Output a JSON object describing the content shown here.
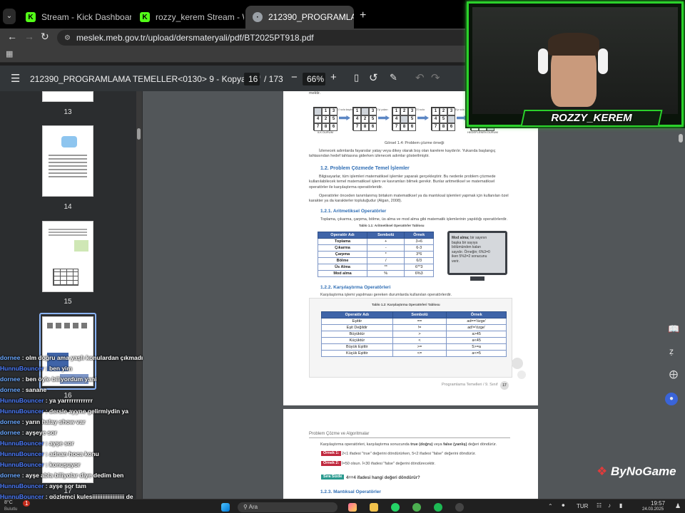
{
  "tabs": [
    {
      "label": "Stream - Kick Dashboard",
      "favicon_color": "#53fc18"
    },
    {
      "label": "rozzy_kerem Stream - Watch Li",
      "favicon_color": "#53fc18"
    },
    {
      "label": "212390_PROGRAMLAMA TEME",
      "favicon_color": "#9aa0a6"
    }
  ],
  "address": {
    "url": "meslek.meb.gov.tr/upload/dersmateryali/pdf/BT2025PT918.pdf"
  },
  "pdf_toolbar": {
    "title": "212390_PROGRAMLAMA TEMELLER<0130> 9 - Kopya.pdf",
    "current_page": "16",
    "total_pages": "/ 173",
    "zoom": "66%"
  },
  "thumbnails": [
    "13",
    "14",
    "15",
    "16",
    "17"
  ],
  "page1": {
    "intro_text": "mektir.",
    "start_label": "İLK DURUM",
    "goal_label": "HEDEFLENEN DURUM",
    "arrow_labels": [
      "1'i sola kaydır",
      "2'yi yukarı",
      "3'ü sola",
      "6'yı sola"
    ],
    "figure_caption": "Görsel 1.4: Problem çözme örneği",
    "para1": "İzlenecek adımlarda fayanslar yatay veya dikey olarak boş olan karelere kaydırılır. Yukarıda başlangıç tahtasından hedef tahtasına giderken izlenecek adımlar gösterilmiştir.",
    "section_title": "1.2. Problem Çözmede Temel İşlemler",
    "para2": "Bilgisayarlar, tüm işlemleri matematiksel işlemler yaparak gerçekleştirir. Bu nedenle problem çözmede kullanılabilecek temel matematiksel işlem ve kavramları bilmek gerekir. Bunlar aritmetiksel ve matematiksel operatörler ile karşılaştırma operatörleridir.",
    "para3": "Operatörler önceden tanımlanmış birtakım matematiksel ya da mantıksal işlemleri yapmak için kullanılan özel karakter ya da karakterler topluluğudur (Algan, 2008).",
    "sub1_title": "1.2.1. Aritmetiksel Operatörler",
    "sub1_text": "Toplama, çıkarma, çarpma, bölme, üs alma ve mod alma gibi matematik işlemlerinin yapıldığı operatörlerdir.",
    "table1_caption": "Tablo 1.1: Aritmetiksel Operatörler Tablosu",
    "table1_headers": [
      "Operatör Adı",
      "Sembolü",
      "Örnek"
    ],
    "table1_rows": [
      [
        "Toplama",
        "+",
        "3+6"
      ],
      [
        "Çıkarma",
        "-",
        "6-3"
      ],
      [
        "Çarpma",
        "*",
        "3*6"
      ],
      [
        "Bölme",
        "/",
        "6/3"
      ],
      [
        "Üs Alma",
        "**",
        "6**3"
      ],
      [
        "Mod alma",
        "%",
        "6%3"
      ]
    ],
    "monitor_note_bold": "Mod alma;",
    "monitor_note": "bir sayının başka bir sayıya bölümünden kalan sayıdır. Örneğin; 6%3=0 iken 5%3=2 sonucunu verir.",
    "sub2_title": "1.2.2. Karşılaştırma Operatörleri",
    "sub2_text": "Karşılaştırma işlemi yapılması gereken durumlarda kullanılan operatörlerdir.",
    "table2_caption": "Tablo 1.2: Karşılaştırma Operatörleri Tablosu",
    "table2_headers": [
      "Operatör Adı",
      "Sembolü",
      "Örnek"
    ],
    "table2_rows": [
      [
        "Eşittir",
        "==",
        "ad=='özge'"
      ],
      [
        "Eşit Değildir",
        "!=",
        "ad!='özge'"
      ],
      [
        "Büyüktür",
        ">",
        "a>45"
      ],
      [
        "Küçüktür",
        "<",
        "a<45"
      ],
      [
        "Büyük Eşittir",
        ">=",
        "5>=a"
      ],
      [
        "Küçük Eşittir",
        "<=",
        "a<=5"
      ]
    ],
    "footer": "Programlama Temelleri / 9. Sınıf",
    "page_no": "17"
  },
  "page2": {
    "header": "Problem Çözme ve Algoritmalar",
    "intro_a": "Karşılaştırma operatörleri, karşılaştırma sonucunda",
    "intro_true": "true (doğru)",
    "intro_b": "veya",
    "intro_false": "false (yanlış)",
    "intro_c": "değeri döndürür.",
    "ex1_tag": "Örnek 1:",
    "ex1_text": "2<1 ifadesi \"true\" değerini döndürürken, 5<2 ifadesi \"false\" değerini döndürür.",
    "ex2_tag": "Örnek 2:",
    "ex2_text": "İ=50 olsun. İ<30 ifadesi \"false\" değerini döndürecektir.",
    "q_tag": "Sıra Sizde",
    "q_text": "4==4 ifadesi hangi değeri döndürür?",
    "sub3_title": "1.2.3. Mantıksal Operatörler"
  },
  "chat": [
    {
      "user": "dornee",
      "msg": "olm doğru ama yaşlı konulardan çıkmadı",
      "color": "#6aa8ff"
    },
    {
      "user": "HunnuBouncer",
      "msg": "ben yim",
      "color": "#4d7dff"
    },
    {
      "user": "dornee",
      "msg": "ben öyle biliyordum yani",
      "color": "#6aa8ff"
    },
    {
      "user": "dornee",
      "msg": "sanane",
      "color": "#6aa8ff"
    },
    {
      "user": "HunnuBouncer",
      "msg": "ya yarrrrrrrrrrrr",
      "color": "#4d7dff"
    },
    {
      "user": "HunnuBouncer",
      "msg": "dersle ayyne gelirmiydin ya",
      "color": "#4d7dff"
    },
    {
      "user": "dornee",
      "msg": "yarın halay show var",
      "color": "#6aa8ff"
    },
    {
      "user": "dornee",
      "msg": "ayşeye sor",
      "color": "#6aa8ff"
    },
    {
      "user": "HunnuBouncer",
      "msg": "ayşe sor",
      "color": "#4d7dff"
    },
    {
      "user": "HunnuBouncer",
      "msg": "adnan hoca konu",
      "color": "#4d7dff"
    },
    {
      "user": "HunnuBouncer",
      "msg": "konuşuyor",
      "color": "#4d7dff"
    },
    {
      "user": "dornee",
      "msg": "ayşe abla biliyolar diye dedim ben",
      "color": "#6aa8ff"
    },
    {
      "user": "HunnuBouncer",
      "msg": "ayşe sor tam",
      "color": "#4d7dff"
    },
    {
      "user": "HunnuBouncer",
      "msg": "gözlemci kulesiiiiiiiiiiiiiiiiiii de",
      "color": "#4d7dff"
    }
  ],
  "webcam": {
    "streamer_name": "ROZZY_KEREM",
    "frame_color": "#2bd12b"
  },
  "watermark": "ByNoGame",
  "taskbar": {
    "weather_temp": "8°C",
    "weather_label": "Bulutlu",
    "notification_count": "1",
    "search_placeholder": "Ara",
    "language": "TUR",
    "time": "19:57",
    "date": "24.03.2025"
  }
}
